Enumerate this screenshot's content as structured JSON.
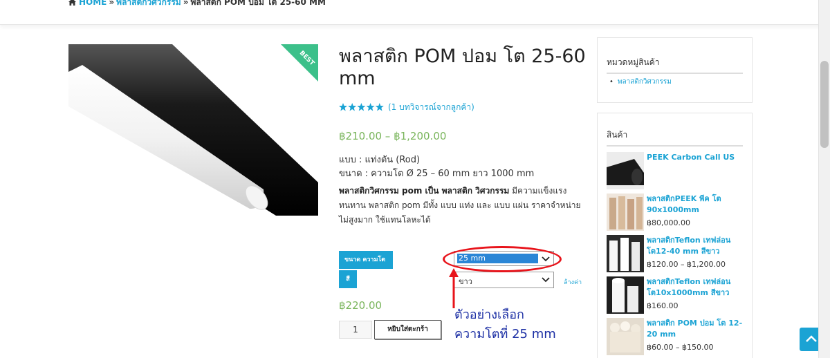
{
  "breadcrumb": {
    "home": "HOME",
    "separator": "»",
    "category": "พลาสติกวิศวกรรม",
    "current": "พลาสติก POM ปอม โต 25-60 MM"
  },
  "product": {
    "badge": "BEST",
    "title": "พลาสติก POM ปอม โต 25-60 mm",
    "rating": 5,
    "reviews_text": "(1 บทวิจารณ์จากลูกค้า)",
    "price_range": "฿210.00 – ฿1,200.00",
    "spec_type": "แบบ : แท่งตัน (Rod)",
    "spec_size": "ขนาด : ความโต Ø 25 – 60 mm ยาว 1000 mm",
    "desc_bold": "พลาสติกวิศกรรม pom เป็น พลาสติก วิศวกรรม",
    "desc_rest": " มีความแข็งแรง ทนทาน พลาสติก pom มีทั้ง แบบ แท่ง และ แบบ แผ่น ราคาจำหน่าย ไม่สูงมาก ใช้แทนโลหะได้",
    "variation_size_label": "ขนาด ความโต",
    "variation_color_label": "สี",
    "selected_size": "25 mm",
    "selected_color": "ขาว",
    "clear_label": "ล้างค่า",
    "variant_price": "฿220.00",
    "quantity": "1",
    "add_to_cart": "หยิบใส่ตะกร้า"
  },
  "annotation": {
    "line1": "ตัวอย่างเลือก",
    "line2": "ความโตที่ 25 mm",
    "color": "#e8141b"
  },
  "sidebar": {
    "categories_title": "หมวดหมู่สินค้า",
    "categories": [
      "พลาสติกวิศวกรรม"
    ],
    "products_title": "สินค้า",
    "products": [
      {
        "name": "PEEK Carbon Call US",
        "price": ""
      },
      {
        "name": "พลาสติกPEEK พีค โต 90x1000mm",
        "price": "฿80,000.00"
      },
      {
        "name": "พลาสติกTeflon เทฟล่อน โต12-40 mm สีขาว",
        "price": "฿120.00 – ฿1,200.00"
      },
      {
        "name": "พลาสติกTeflon เทฟล่อน โต10x1000mm สีขาว",
        "price": "฿160.00"
      },
      {
        "name": "พลาสติก POM ปอม โต 12-20 mm",
        "price": "฿60.00 – ฿150.00"
      }
    ]
  },
  "colors": {
    "accent": "#1ba3d4",
    "price": "#7ab55c",
    "badge": "#3cc08a"
  }
}
